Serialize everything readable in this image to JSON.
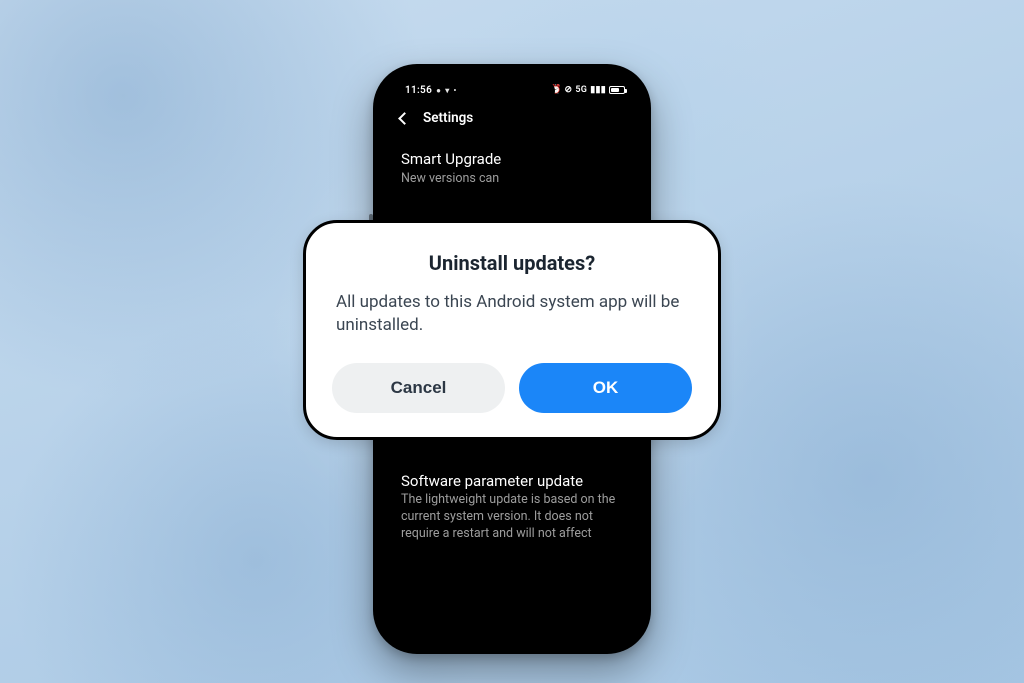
{
  "statusbar": {
    "time": "11:56",
    "left_icon1": "●",
    "left_icon2": "▾",
    "left_icon3": "•",
    "alarm": "⏰",
    "dnd": "⊘",
    "signal_label": "5G",
    "signal_bars": "▮▮▮"
  },
  "header": {
    "title": "Settings"
  },
  "settings": {
    "item1_title": "Smart Upgrade",
    "item1_sub": "New versions can",
    "item2_title": "Software parameter update",
    "item2_sub": "The lightweight update is based on the current system version. It does not require a restart and will not affect"
  },
  "dialog": {
    "title": "Uninstall updates?",
    "message": "All updates to this Android system app will be uninstalled.",
    "cancel_label": "Cancel",
    "ok_label": "OK"
  }
}
